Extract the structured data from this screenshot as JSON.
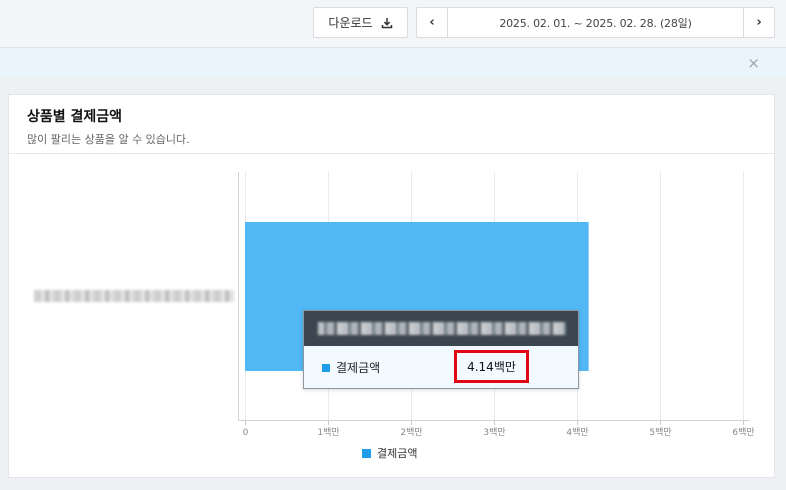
{
  "toolbar": {
    "download_label": "다운로드",
    "download_icon": "download-icon",
    "prev_label": "‹",
    "next_label": "›",
    "date_range": "2025. 02. 01. ~ 2025. 02. 28. (28일)"
  },
  "notice": {
    "close_label": "×"
  },
  "card": {
    "title": "상품별 결제금액",
    "subtitle": "많이 팔리는 상품을 알 수 있습니다."
  },
  "chart_data": {
    "type": "bar",
    "orientation": "horizontal",
    "categories": [
      "(blurred product name)"
    ],
    "series": [
      {
        "name": "결제금액",
        "values": [
          4140000
        ],
        "color": "#52b7f5"
      }
    ],
    "x_ticks": [
      {
        "value": 0,
        "label": "0"
      },
      {
        "value": 1000000,
        "label": "1백만"
      },
      {
        "value": 2000000,
        "label": "2백만"
      },
      {
        "value": 3000000,
        "label": "3백만"
      },
      {
        "value": 4000000,
        "label": "4백만"
      },
      {
        "value": 5000000,
        "label": "5백만"
      },
      {
        "value": 6000000,
        "label": "6백만"
      }
    ],
    "xlim": [
      0,
      6000000
    ],
    "grid": true,
    "legend": "bottom"
  },
  "legend": {
    "label": "결제금액"
  },
  "tooltip": {
    "series_label": "결제금액",
    "value_label": "4.14백만"
  }
}
